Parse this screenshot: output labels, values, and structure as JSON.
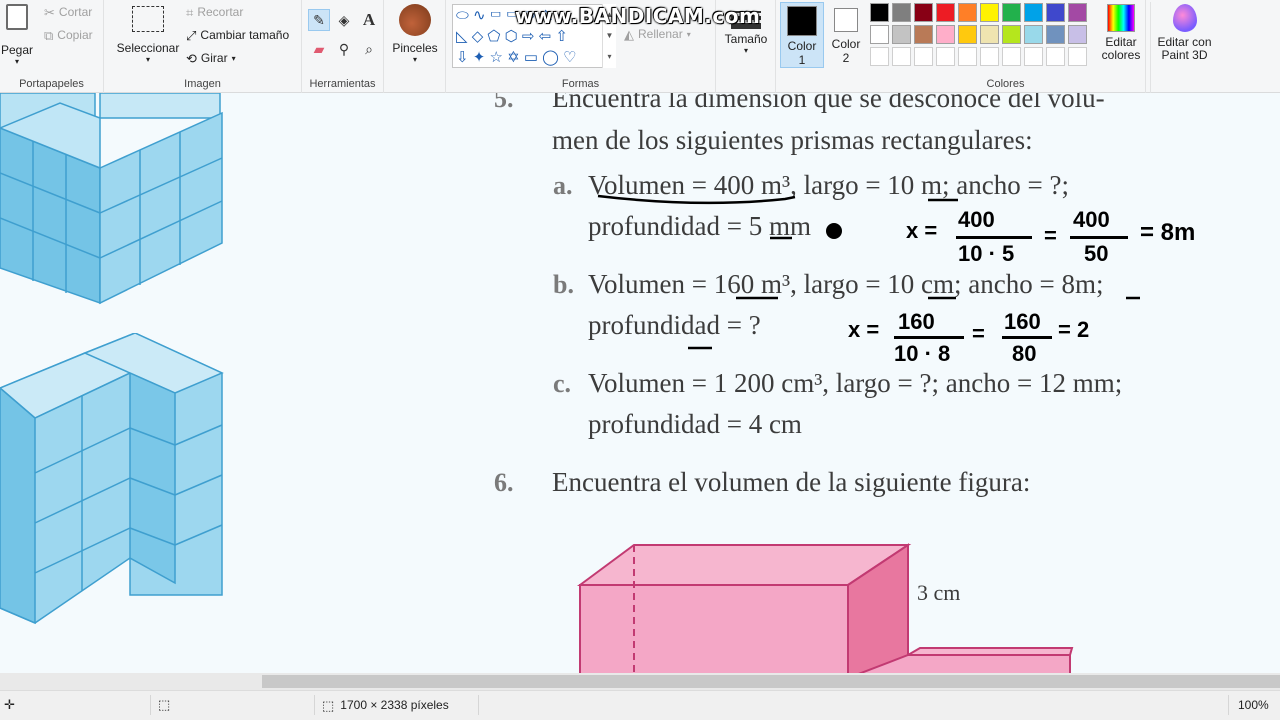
{
  "ribbon": {
    "clipboard": {
      "paste": "Pegar",
      "cut": "Cortar",
      "copy": "Copiar",
      "label": "Portapapeles"
    },
    "image": {
      "select": "Seleccionar",
      "crop": "Recortar",
      "resize": "Cambiar tamaño",
      "rotate": "Girar",
      "label": "Imagen"
    },
    "tools": {
      "label": "Herramientas"
    },
    "brushes": {
      "label": "Pinceles"
    },
    "shapes": {
      "fill": "Rellenar",
      "label": "Formas"
    },
    "size": {
      "label": "Tamaño"
    },
    "color1": {
      "label": "Color 1",
      "value": "#000000"
    },
    "color2": {
      "label": "Color 2",
      "value": "#ffffff"
    },
    "colors": {
      "label": "Colores",
      "row1": [
        "#000000",
        "#7f7f7f",
        "#880015",
        "#ed1c24",
        "#ff7f27",
        "#fff200",
        "#22b14c",
        "#00a2e8",
        "#3f48cc",
        "#a349a4"
      ],
      "row2": [
        "#ffffff",
        "#c3c3c3",
        "#b97a57",
        "#ffaec9",
        "#ffc90e",
        "#efe4b0",
        "#b5e61d",
        "#99d9ea",
        "#7092be",
        "#c8bfe7"
      ]
    },
    "edit_colors": "Editar colores",
    "paint3d": "Editar con Paint 3D"
  },
  "watermark": "www.BANDICAM.com",
  "document": {
    "q5_num": "5.",
    "q5_line1": "Encuentra la dimensión que se desconoce del volu-",
    "q5_line2": "men de los siguientes prismas rectangulares:",
    "a_label": "a.",
    "a_line1": "Volumen = 400 m³, largo = 10 m; ancho = ?;",
    "a_line2": "profundidad = 5 mm",
    "b_label": "b.",
    "b_line1": "Volumen = 160 m³, largo = 10 cm; ancho = 8m;",
    "b_line2": "profundidad = ?",
    "c_label": "c.",
    "c_line1": "Volumen = 1 200 cm³, largo = ?; ancho = 12 mm;",
    "c_line2": "profundidad = 4 cm",
    "q6_num": "6.",
    "q6_text": "Encuentra el volumen de la siguiente figura:",
    "dim_label": "3 cm",
    "hand_a": {
      "x": "x =",
      "num1": "400",
      "den1": "10 · 5",
      "num2": "400",
      "den2": "50",
      "result": "= 8m"
    },
    "hand_b": {
      "x": "x =",
      "num1": "160",
      "den1": "10 · 8",
      "num2": "160",
      "den2": "80",
      "result": "= 2"
    }
  },
  "status": {
    "dimensions": "1700 × 2338 píxeles",
    "zoom": "100%"
  }
}
